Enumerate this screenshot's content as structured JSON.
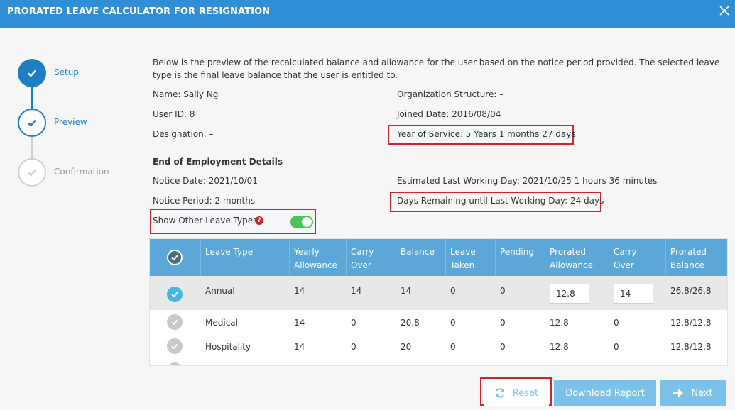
{
  "window": {
    "title": "PRORATED LEAVE CALCULATOR FOR RESIGNATION"
  },
  "steps": [
    {
      "label": "Setup",
      "state": "done"
    },
    {
      "label": "Preview",
      "state": "active"
    },
    {
      "label": "Confirmation",
      "state": "pending"
    }
  ],
  "intro": "Below is the preview of the recalculated balance and allowance for the user based on the notice period provided. The selected leave type is the final leave balance that the user is entitled to.",
  "user": {
    "name": "Name:  Sally Ng",
    "user_id": "User ID:  8",
    "designation": "Designation:  –",
    "org_structure": "Organization Structure:  –",
    "joined_date": "Joined Date:  2016/08/04",
    "year_of_service": "Year of Service: 5 Years 1 months 27 days"
  },
  "employment": {
    "heading": "End of Employment Details",
    "notice_date": "Notice Date: 2021/10/01",
    "notice_period": "Notice Period: 2 months",
    "last_working_day": "Estimated Last Working Day: 2021/10/25 1 hours 36 minutes",
    "days_remaining": "Days Remaining until Last Working Day: 24 days"
  },
  "toggle": {
    "label": "Show Other Leave Types",
    "on": true
  },
  "table": {
    "headers": {
      "leave_type": "Leave Type",
      "yearly_1": "Yearly",
      "yearly_2": "Allowance",
      "carry_1": "Carry",
      "carry_2": "Over",
      "balance": "Balance",
      "taken_1": "Leave",
      "taken_2": "Taken",
      "pending": "Pending",
      "pro_alw_1": "Prorated",
      "pro_alw_2": "Allowance",
      "pro_carry_1": "Carry",
      "pro_carry_2": "Over",
      "pro_bal_1": "Prorated",
      "pro_bal_2": "Balance"
    },
    "rows": [
      {
        "type": "Annual",
        "yearly": "14",
        "carry": "14",
        "balance": "14",
        "taken": "0",
        "pending": "0",
        "pro_alw": "12.8",
        "pro_carry": "14",
        "pro_bal": "26.8/26.8",
        "selected": true
      },
      {
        "type": "Medical",
        "yearly": "14",
        "carry": "0",
        "balance": "20.8",
        "taken": "0",
        "pending": "0",
        "pro_alw": "12.8",
        "pro_carry": "0",
        "pro_bal": "12.8/12.8",
        "selected": false
      },
      {
        "type": "Hospitality",
        "yearly": "14",
        "carry": "0",
        "balance": "20",
        "taken": "0",
        "pending": "0",
        "pro_alw": "12.8",
        "pro_carry": "0",
        "pro_bal": "12.8/12.8",
        "selected": false
      }
    ]
  },
  "buttons": {
    "reset": "Reset",
    "download": "Download Report",
    "next": "Next"
  },
  "colors": {
    "title_bar": "#2e8fd6",
    "step_active": "#1f7fc4",
    "table_header": "#5aa7d8",
    "highlight": "#d0232a",
    "button": "#7cc2e8",
    "toggle": "#4cc25a"
  }
}
